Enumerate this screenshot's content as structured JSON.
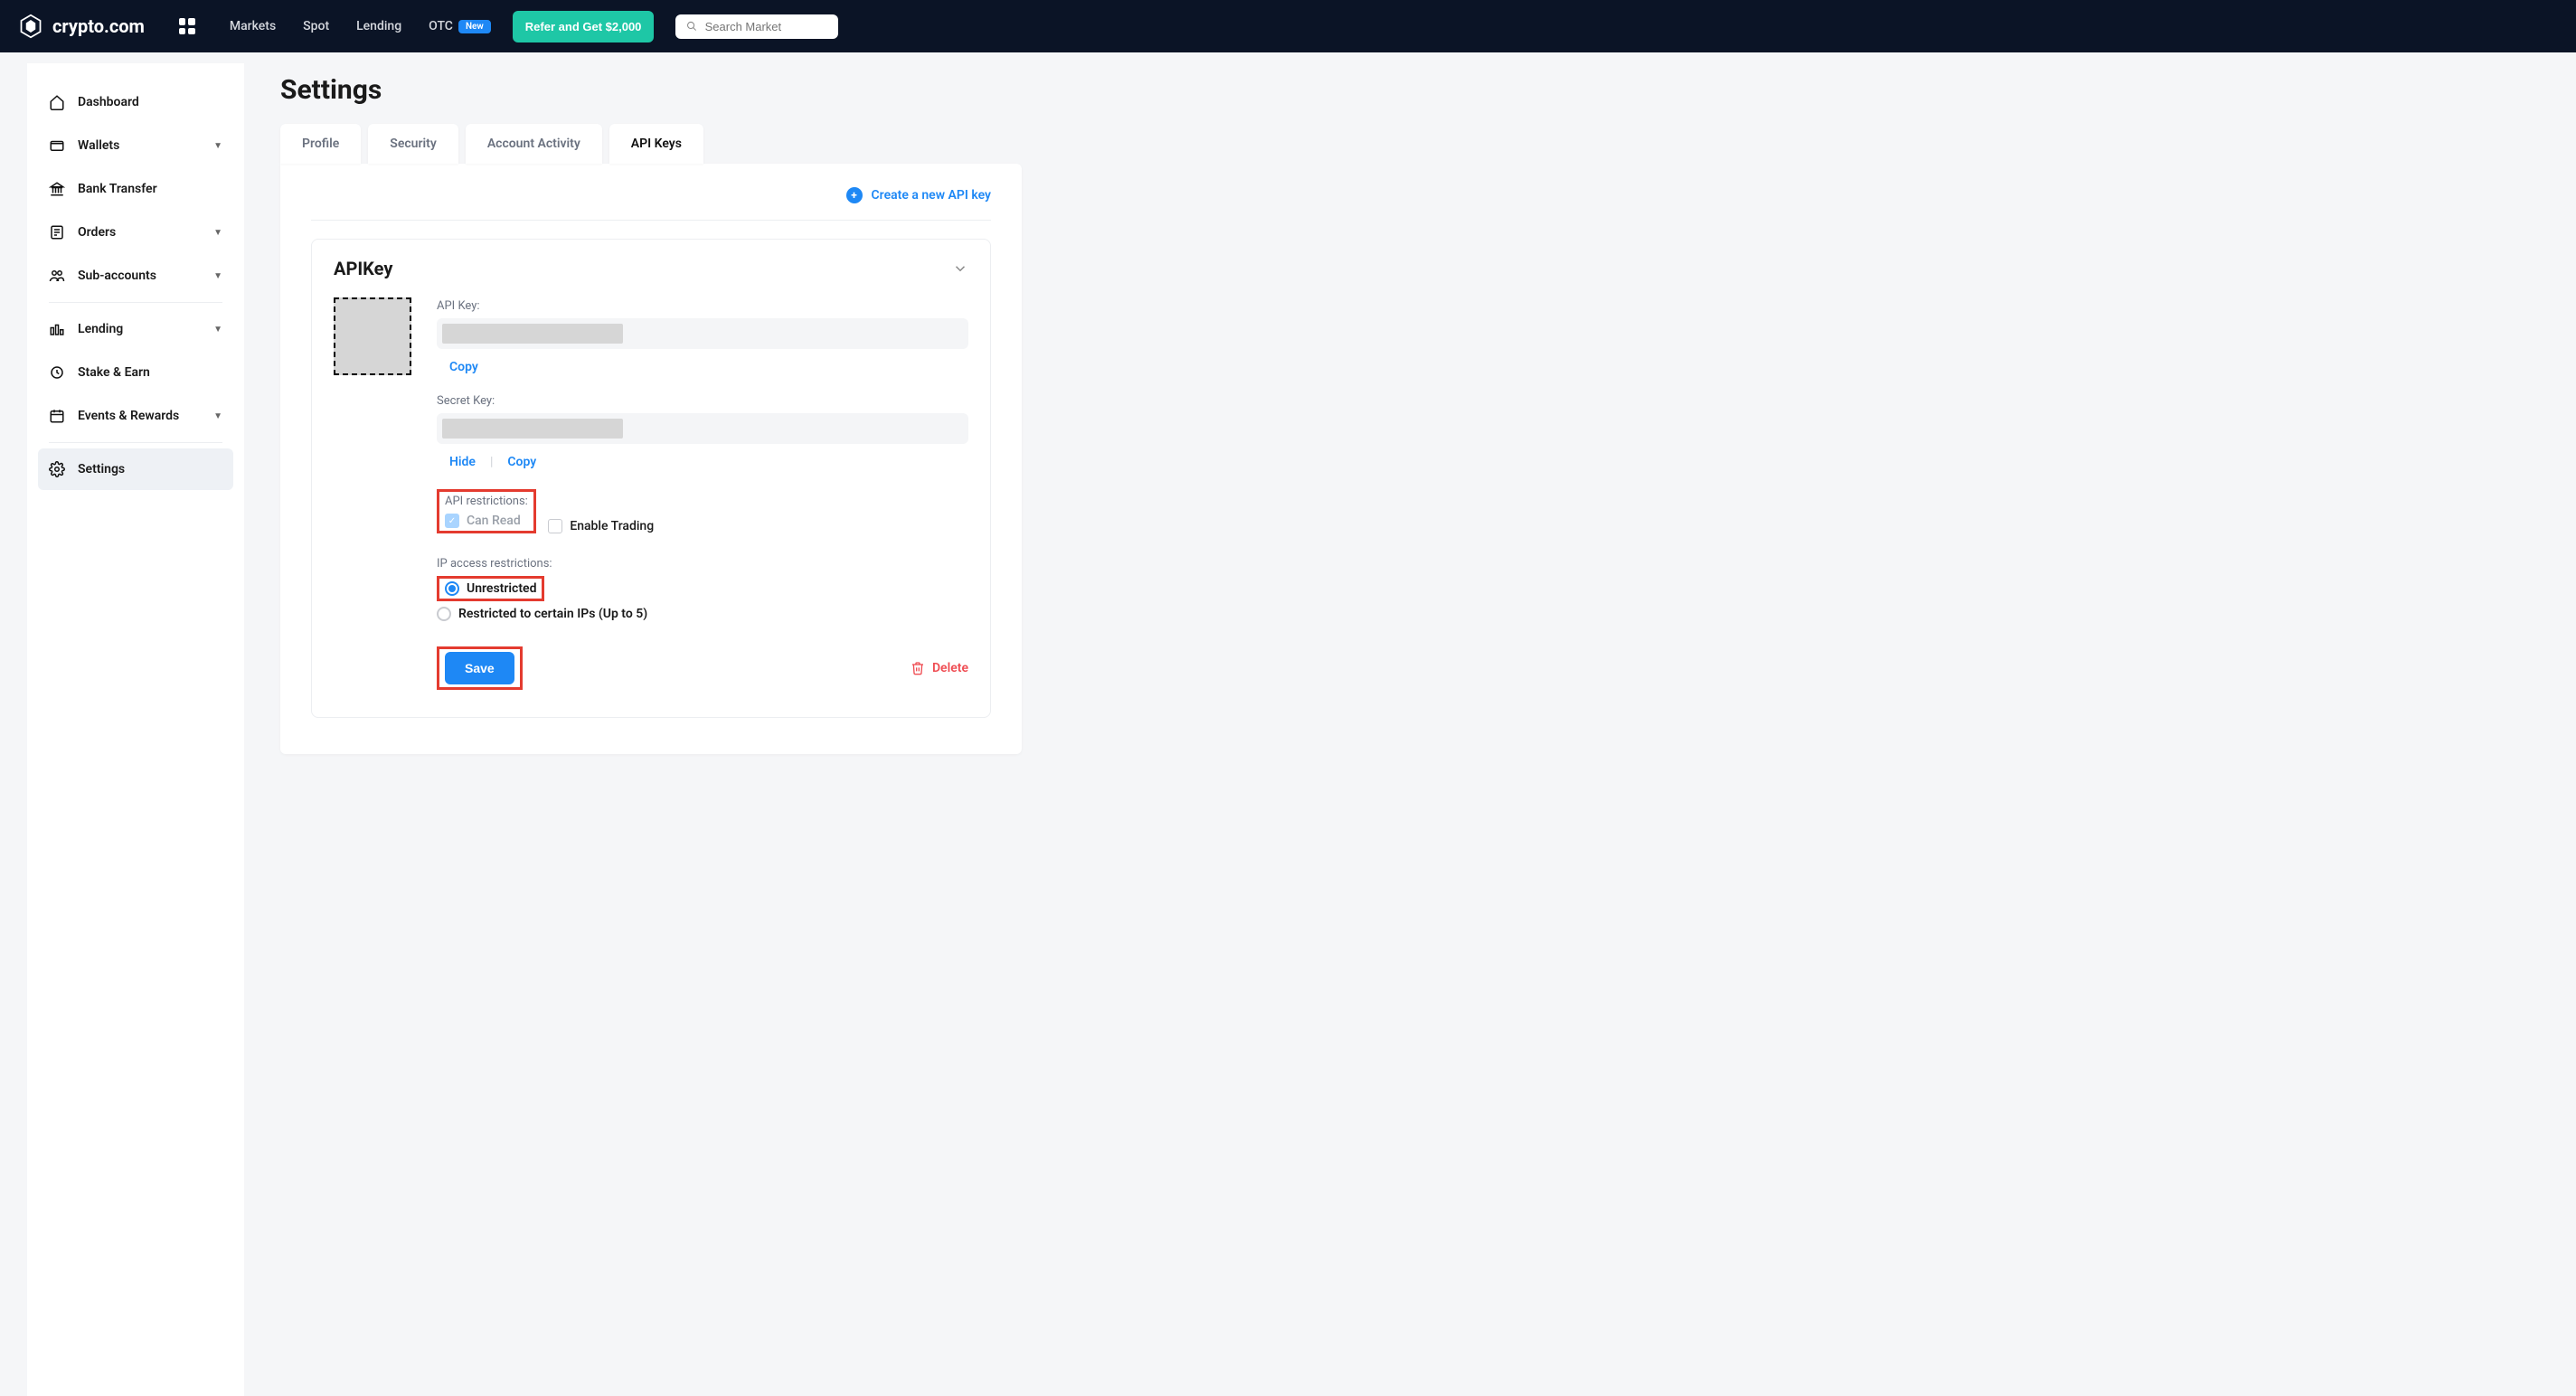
{
  "brand": "crypto.com",
  "header": {
    "nav": [
      "Markets",
      "Spot",
      "Lending"
    ],
    "otc_label": "OTC",
    "new_badge": "New",
    "cta": "Refer and Get $2,000",
    "search_placeholder": "Search Market"
  },
  "sidebar": {
    "items": [
      {
        "label": "Dashboard",
        "expandable": false
      },
      {
        "label": "Wallets",
        "expandable": true
      },
      {
        "label": "Bank Transfer",
        "expandable": false
      },
      {
        "label": "Orders",
        "expandable": true
      },
      {
        "label": "Sub-accounts",
        "expandable": true
      },
      {
        "label": "Lending",
        "expandable": true
      },
      {
        "label": "Stake & Earn",
        "expandable": false
      },
      {
        "label": "Events & Rewards",
        "expandable": true
      },
      {
        "label": "Settings",
        "expandable": false,
        "active": true
      }
    ]
  },
  "page": {
    "title": "Settings",
    "tabs": [
      "Profile",
      "Security",
      "Account Activity",
      "API Keys"
    ],
    "active_tab": "API Keys",
    "create_label": "Create a new API key"
  },
  "card": {
    "title": "APIKey",
    "api_key_label": "API Key:",
    "secret_key_label": "Secret Key:",
    "copy": "Copy",
    "hide": "Hide",
    "restrictions_label": "API restrictions:",
    "can_read": "Can Read",
    "enable_trading": "Enable Trading",
    "ip_label": "IP access restrictions:",
    "unrestricted": "Unrestricted",
    "restricted": "Restricted to certain IPs (Up to 5)",
    "save": "Save",
    "delete": "Delete"
  },
  "colors": {
    "accent": "#1e88f5",
    "cta_green": "#1ec7a6",
    "danger": "#ef4c52",
    "highlight": "#e43b2f"
  }
}
